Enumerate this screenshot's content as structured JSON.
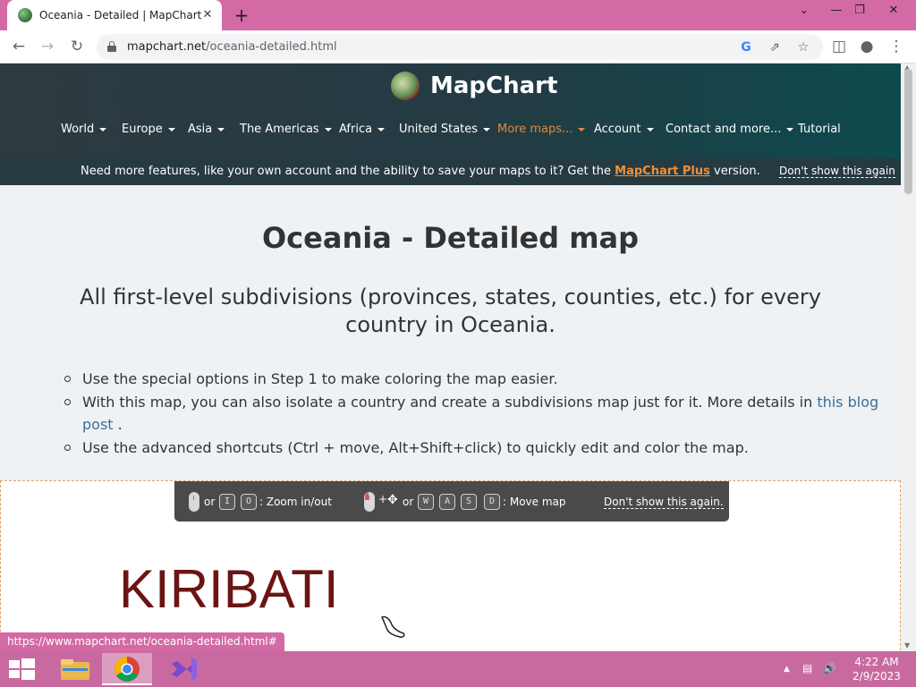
{
  "browser": {
    "tab_title": "Oceania - Detailed | MapChart",
    "tab_close": "✕",
    "new_tab": "+",
    "url_host": "mapchart.net",
    "url_path": "/oceania-detailed.html",
    "controls": {
      "minimize": "⌄",
      "restore": "—",
      "maximize": "❐",
      "close": "✕"
    }
  },
  "site": {
    "brand": "MapChart",
    "nav": [
      {
        "label": "World"
      },
      {
        "label": "Europe"
      },
      {
        "label": "Asia"
      },
      {
        "label": "The Americas"
      },
      {
        "label": "Africa"
      },
      {
        "label": "United States"
      },
      {
        "label": "More maps..."
      },
      {
        "label": "Account"
      },
      {
        "label": "Contact and more..."
      },
      {
        "label": "Tutorial"
      }
    ],
    "promo": {
      "text_before": "Need more features, like your own account and the ability to save your maps to it? Get the ",
      "link": "MapChart Plus",
      "text_after": " version.",
      "dismiss": "Don't show this again"
    }
  },
  "page": {
    "title": "Oceania - Detailed map",
    "subtitle": "All first-level subdivisions (provinces, states, counties, etc.) for every country in Oceania.",
    "bullets": [
      {
        "text": "Use the special options in Step 1 to make coloring the map easier."
      },
      {
        "text_before": "With this map, you can also isolate a country and create a subdivisions map just for it. More details in ",
        "link": "this blog post",
        "text_after": " ."
      },
      {
        "text": "Use the advanced shortcuts (Ctrl + move, Alt+Shift+click) to quickly edit and color the map."
      }
    ]
  },
  "hints": {
    "or_1": "or",
    "key_i": "I",
    "key_o": "O",
    "zoom_label": ": Zoom in/out",
    "plus": "+",
    "or_2": "or",
    "key_w": "W",
    "key_a": "A",
    "key_s": "S",
    "key_d": "D",
    "move_label": ": Move map",
    "dismiss": "Don't show this again."
  },
  "map": {
    "label": "KIRIBATI"
  },
  "status_url": "https://www.mapchart.net/oceania-detailed.html#",
  "taskbar": {
    "time": "4:22 AM",
    "date": "2/9/2023"
  },
  "colors": {
    "tabbar": "#d36aa5",
    "header_dark": "#233b44",
    "accent_orange": "#e3893c",
    "content_bg": "#eef2f4",
    "map_label": "#6b1414",
    "taskbar": "#c86aa0"
  }
}
